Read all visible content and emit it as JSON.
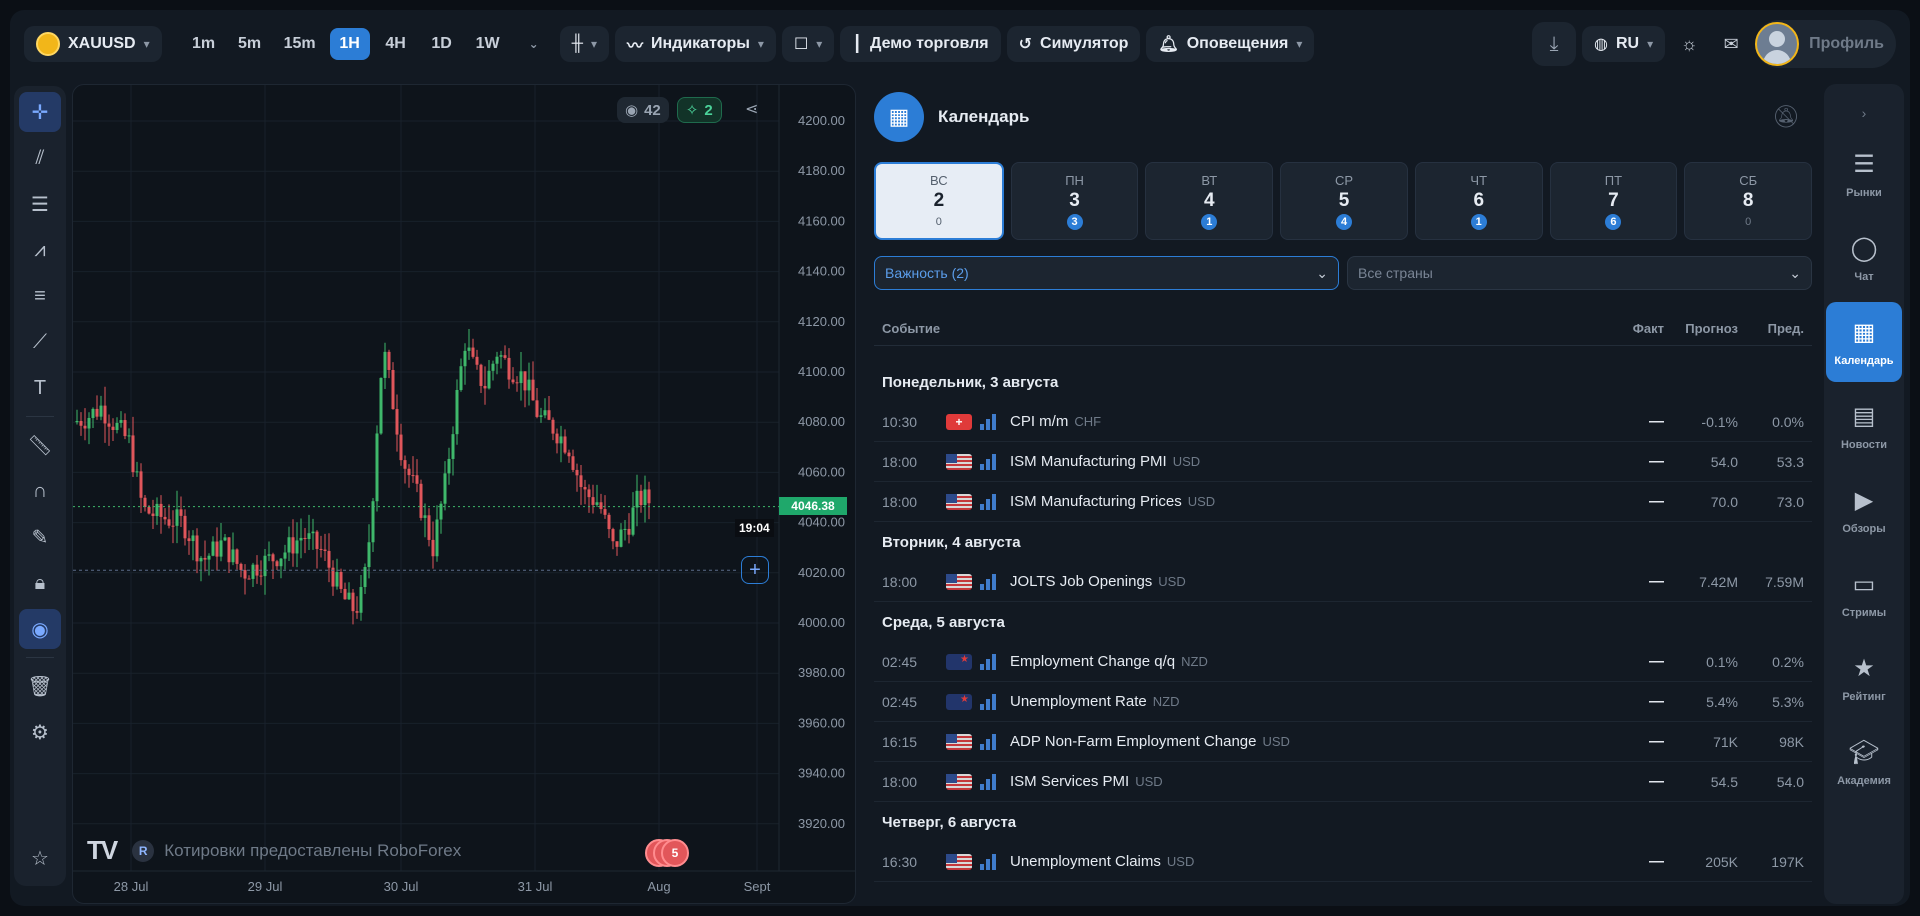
{
  "topbar": {
    "symbol": "XAUUSD",
    "timeframes": [
      "1m",
      "5m",
      "15m",
      "1H",
      "4H",
      "1D",
      "1W"
    ],
    "active_timeframe": "1H",
    "indicators_label": "Индикаторы",
    "demo_label": "Демо торговля",
    "simulator_label": "Симулятор",
    "alerts_label": "Оповещения",
    "language": "RU",
    "profile_label": "Профиль"
  },
  "chart": {
    "views_count": "42",
    "ideas_count": "2",
    "current_price": "4046.38",
    "countdown": "19:04",
    "attribution": "Котировки предоставлены RoboForex",
    "events_count": "5",
    "y_ticks": [
      "4200.00",
      "4180.00",
      "4160.00",
      "4140.00",
      "4120.00",
      "4100.00",
      "4080.00",
      "4060.00",
      "4040.00",
      "4020.00",
      "4000.00",
      "3980.00",
      "3960.00",
      "3940.00",
      "3920.00"
    ],
    "x_ticks": [
      "28 Jul",
      "29 Jul",
      "30 Jul",
      "31 Jul",
      "Aug",
      "Sept"
    ],
    "colors": {
      "up": "#3fb86b",
      "down": "#e0565b",
      "accent": "#2c7dd6"
    }
  },
  "calendar": {
    "title": "Календарь",
    "days": [
      {
        "name": "ВС",
        "num": "2",
        "count": "0",
        "selected": true
      },
      {
        "name": "ПН",
        "num": "3",
        "count": "3"
      },
      {
        "name": "ВТ",
        "num": "4",
        "count": "1"
      },
      {
        "name": "СР",
        "num": "5",
        "count": "4"
      },
      {
        "name": "ЧТ",
        "num": "6",
        "count": "1"
      },
      {
        "name": "ПТ",
        "num": "7",
        "count": "6"
      },
      {
        "name": "СБ",
        "num": "8",
        "count": "0"
      }
    ],
    "filter_importance": "Важность (2)",
    "filter_countries": "Все страны",
    "columns": {
      "event": "Событие",
      "fact": "Факт",
      "forecast": "Прогноз",
      "prev": "Пред."
    },
    "groups": [
      {
        "title": "Понедельник, 3 августа",
        "rows": [
          {
            "time": "10:30",
            "flag": "ch",
            "name": "CPI m/m",
            "cur": "CHF",
            "fact": "—",
            "forecast": "-0.1%",
            "prev": "0.0%"
          },
          {
            "time": "18:00",
            "flag": "us",
            "name": "ISM Manufacturing PMI",
            "cur": "USD",
            "fact": "—",
            "forecast": "54.0",
            "prev": "53.3"
          },
          {
            "time": "18:00",
            "flag": "us",
            "name": "ISM Manufacturing Prices",
            "cur": "USD",
            "fact": "—",
            "forecast": "70.0",
            "prev": "73.0"
          }
        ]
      },
      {
        "title": "Вторник, 4 августа",
        "rows": [
          {
            "time": "18:00",
            "flag": "us",
            "name": "JOLTS Job Openings",
            "cur": "USD",
            "fact": "—",
            "forecast": "7.42M",
            "prev": "7.59M"
          }
        ]
      },
      {
        "title": "Среда, 5 августа",
        "rows": [
          {
            "time": "02:45",
            "flag": "nz",
            "name": "Employment Change q/q",
            "cur": "NZD",
            "fact": "—",
            "forecast": "0.1%",
            "prev": "0.2%"
          },
          {
            "time": "02:45",
            "flag": "nz",
            "name": "Unemployment Rate",
            "cur": "NZD",
            "fact": "—",
            "forecast": "5.4%",
            "prev": "5.3%"
          },
          {
            "time": "16:15",
            "flag": "us",
            "name": "ADP Non-Farm Employment Change",
            "cur": "USD",
            "fact": "—",
            "forecast": "71K",
            "prev": "98K"
          },
          {
            "time": "18:00",
            "flag": "us",
            "name": "ISM Services PMI",
            "cur": "USD",
            "fact": "—",
            "forecast": "54.5",
            "prev": "54.0"
          }
        ]
      },
      {
        "title": "Четверг, 6 августа",
        "rows": [
          {
            "time": "16:30",
            "flag": "us",
            "name": "Unemployment Claims",
            "cur": "USD",
            "fact": "—",
            "forecast": "205K",
            "prev": "197K"
          }
        ]
      }
    ]
  },
  "rightnav": [
    {
      "label": "Рынки",
      "icon": "list-icon"
    },
    {
      "label": "Чат",
      "icon": "chat-icon"
    },
    {
      "label": "Календарь",
      "icon": "calendar-icon",
      "active": true
    },
    {
      "label": "Новости",
      "icon": "news-icon"
    },
    {
      "label": "Обзоры",
      "icon": "play-icon"
    },
    {
      "label": "Стримы",
      "icon": "video-icon"
    },
    {
      "label": "Рейтинг",
      "icon": "star-icon"
    },
    {
      "label": "Академия",
      "icon": "academy-icon"
    }
  ]
}
